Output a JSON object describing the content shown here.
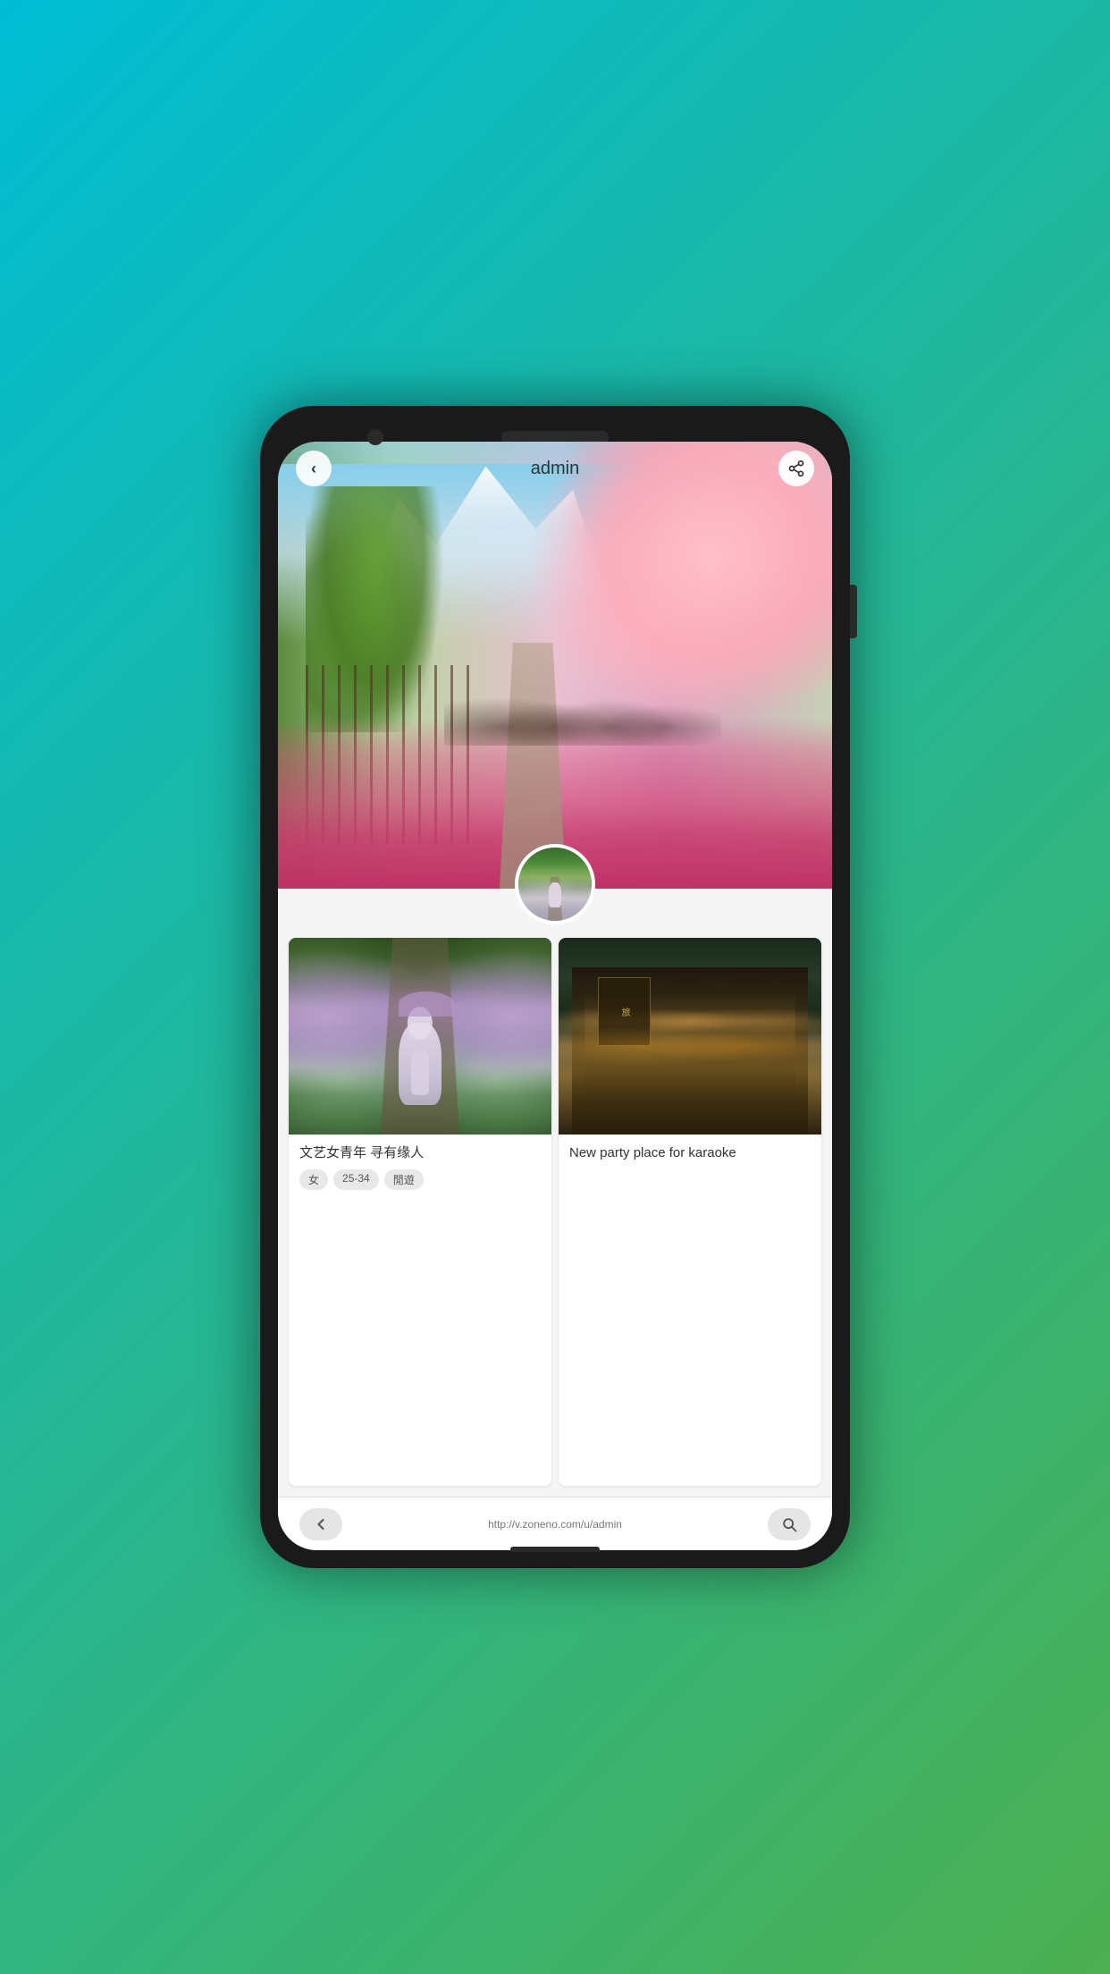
{
  "phone": {
    "background_gradient_start": "#00bcd4",
    "background_gradient_end": "#4caf50"
  },
  "header": {
    "title": "admin",
    "back_label": "‹",
    "share_icon": "share"
  },
  "hero": {
    "scene_description": "Cherry blossom park path with pink flowers and mountains"
  },
  "avatar": {
    "description": "User avatar - woman in garden path"
  },
  "cards": [
    {
      "id": "card-1",
      "image_description": "Woman in kimono with umbrella on garden path surrounded by hydrangeas",
      "title": "文艺女青年 寻有缘人",
      "tags": [
        "女",
        "25-34",
        "閒遊"
      ]
    },
    {
      "id": "card-2",
      "image_description": "Japanese traditional street at night with warm lights and signs",
      "title": "New party place for karaoke",
      "tags": []
    }
  ],
  "bottom_nav": {
    "back_label": "‹",
    "search_icon": "🔍",
    "url": "http://v.zoneno.com/u/admin"
  },
  "icons": {
    "back": "‹",
    "share": "⤴",
    "search": "⌕"
  }
}
